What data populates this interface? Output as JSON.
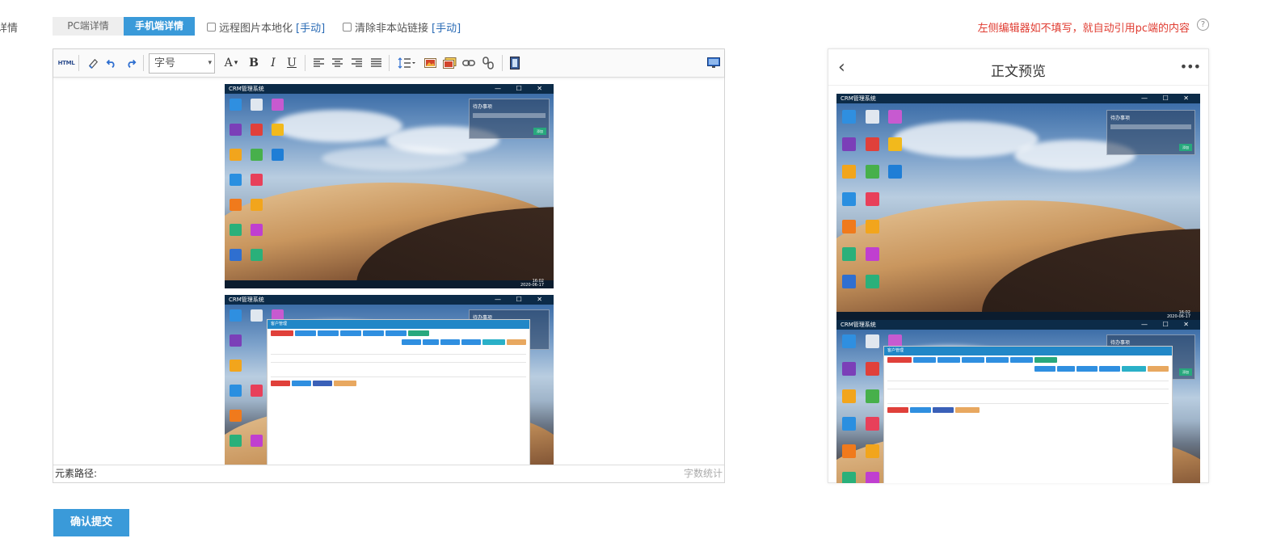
{
  "row_label": "详情",
  "tabs": {
    "pc": "PC端详情",
    "mobile": "手机端详情"
  },
  "options": {
    "remote_image": "远程图片本地化",
    "remote_image_manual": "[手动]",
    "clear_links": "清除非本站链接",
    "clear_links_manual": "[手动]"
  },
  "hint": "左侧编辑器如不填写，就自动引用pc端的内容",
  "help_icon": "?",
  "toolbar": {
    "html": "HTML",
    "font_size_placeholder": "字号",
    "font_size_dropdown": "▾",
    "font_color": "A",
    "bold": "B",
    "italic": "I",
    "underline": "U"
  },
  "editor_status": {
    "path_label": "元素路径:",
    "word_count": "字数统计"
  },
  "screenshot": {
    "window_title": "CRM管理系统",
    "window_controls": "— ☐ ✕",
    "widget_title": "待办事项",
    "widget_button": "添加",
    "clock_time": "16:02",
    "clock_date": "2020-06-17",
    "app_title": "客户管理"
  },
  "preview": {
    "back": "‹",
    "title": "正文预览",
    "more": "•••"
  },
  "submit_label": "确认提交",
  "colors": {
    "primary": "#3a9ad9",
    "hint": "#e03c31",
    "link": "#2a6bb5"
  }
}
